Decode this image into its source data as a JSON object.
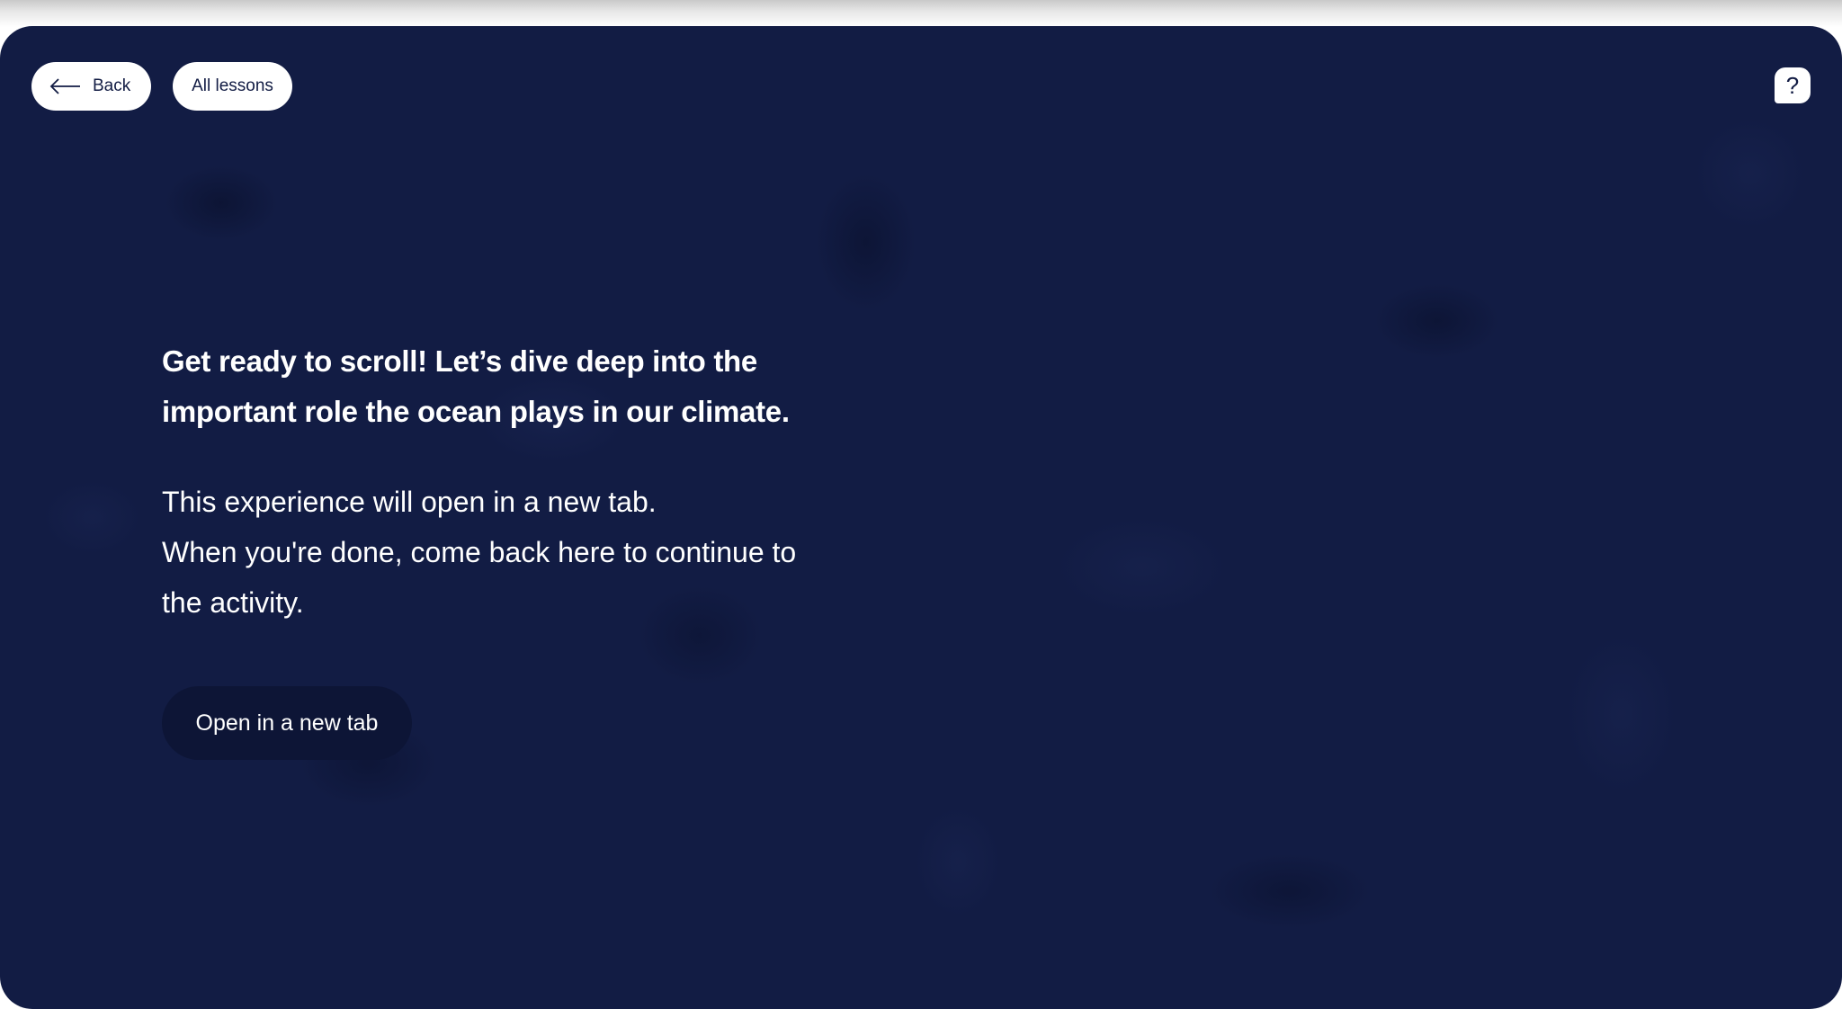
{
  "nav": {
    "back_label": "Back",
    "back_icon": "arrow-left-icon",
    "all_lessons_label": "All lessons",
    "help_label": "?",
    "help_icon": "help-question-icon"
  },
  "main": {
    "headline_line1": "Get ready to scroll! Let’s dive deep into the",
    "headline_line2": "important role the ocean plays in our climate.",
    "desc_line1": "This experience will open in a new tab.",
    "desc_line2": "When you're done, come back here to continue to",
    "desc_line3": "the activity.",
    "open_button_label": "Open in a new tab"
  },
  "colors": {
    "background": "#121c44",
    "button_dark": "#0d1536",
    "pill": "#ffffff"
  }
}
